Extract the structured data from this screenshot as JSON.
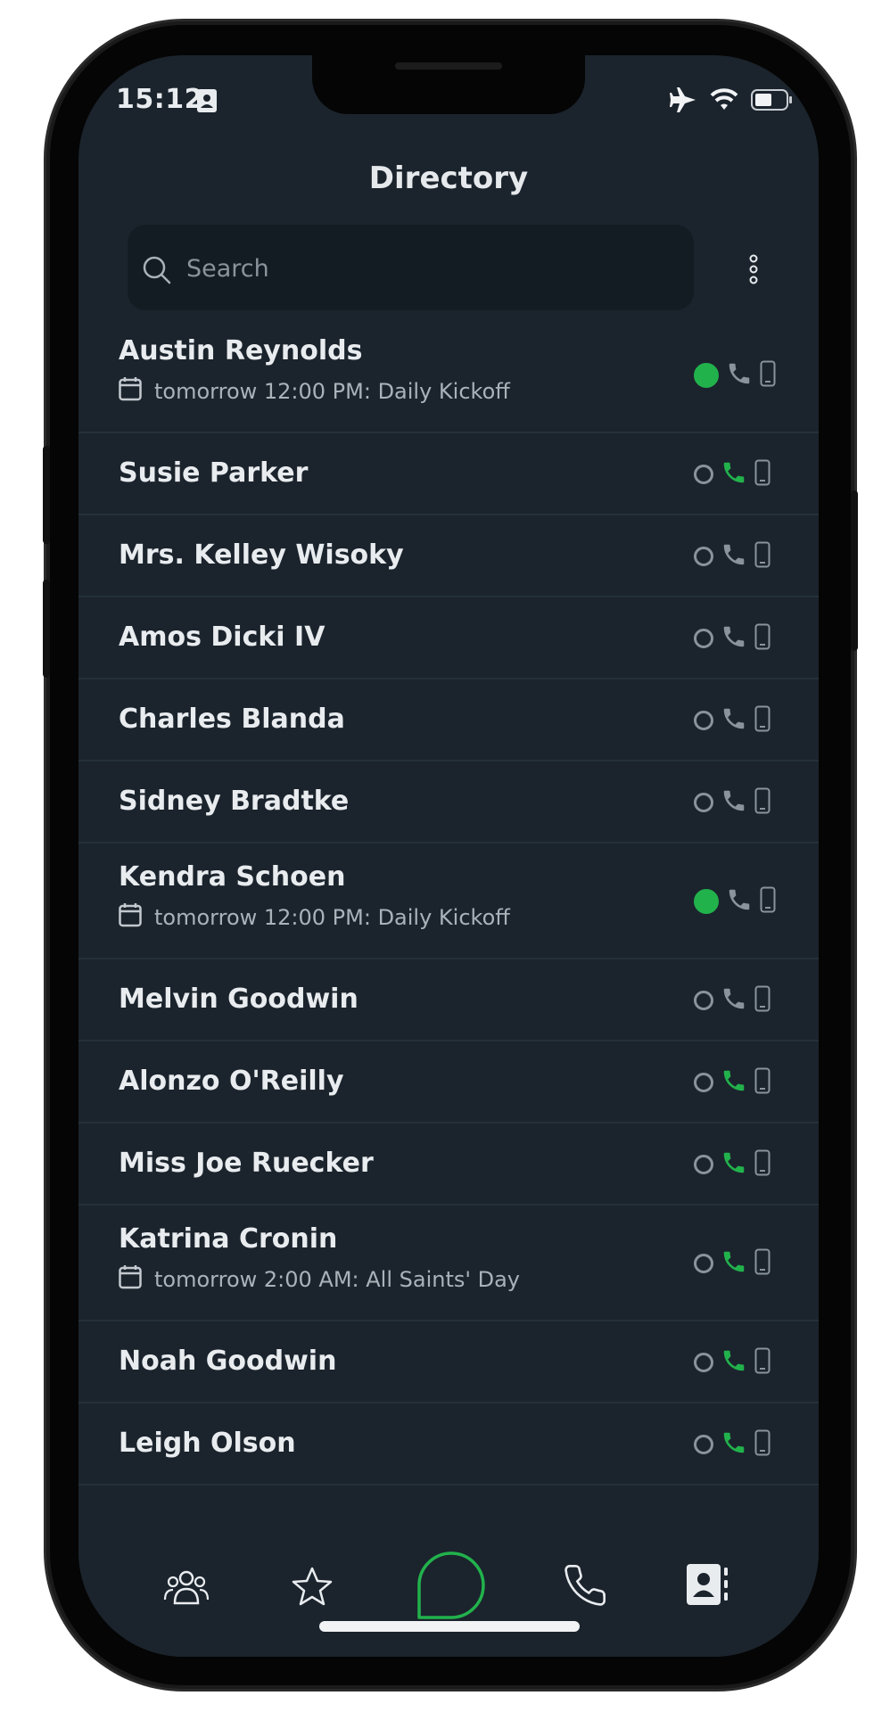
{
  "status_bar": {
    "time": "15:12",
    "icons": [
      "contact-card-icon",
      "airplane-icon",
      "wifi-icon",
      "battery-icon"
    ]
  },
  "header": {
    "title": "Directory"
  },
  "search": {
    "placeholder": "Search"
  },
  "colors": {
    "background": "#1b242d",
    "accent_green": "#22b24c",
    "text_primary": "#e9ecef",
    "text_secondary": "#aab2b9",
    "icon_gray": "#8a939b"
  },
  "contacts": [
    {
      "name": "Austin Reynolds",
      "event": "tomorrow 12:00 PM: Daily Kickoff",
      "online": true,
      "phone_active": false
    },
    {
      "name": "Susie Parker",
      "event": "",
      "online": false,
      "phone_active": true
    },
    {
      "name": "Mrs. Kelley Wisoky",
      "event": "",
      "online": false,
      "phone_active": false
    },
    {
      "name": "Amos Dicki IV",
      "event": "",
      "online": false,
      "phone_active": false
    },
    {
      "name": "Charles Blanda",
      "event": "",
      "online": false,
      "phone_active": false
    },
    {
      "name": "Sidney Bradtke",
      "event": "",
      "online": false,
      "phone_active": false
    },
    {
      "name": "Kendra Schoen",
      "event": "tomorrow 12:00 PM: Daily Kickoff",
      "online": true,
      "phone_active": false
    },
    {
      "name": "Melvin Goodwin",
      "event": "",
      "online": false,
      "phone_active": false
    },
    {
      "name": "Alonzo O'Reilly",
      "event": "",
      "online": false,
      "phone_active": true
    },
    {
      "name": "Miss Joe Ruecker",
      "event": "",
      "online": false,
      "phone_active": true
    },
    {
      "name": "Katrina Cronin",
      "event": "tomorrow 2:00 AM: All Saints' Day",
      "online": false,
      "phone_active": true
    },
    {
      "name": "Noah Goodwin",
      "event": "",
      "online": false,
      "phone_active": true
    },
    {
      "name": "Leigh Olson",
      "event": "",
      "online": false,
      "phone_active": true
    }
  ],
  "tabbar": {
    "tabs": [
      {
        "icon": "people-icon",
        "active": false
      },
      {
        "icon": "star-icon",
        "active": false
      },
      {
        "icon": "chat-bubble-icon",
        "active": false
      },
      {
        "icon": "phone-icon",
        "active": false
      },
      {
        "icon": "contacts-book-icon",
        "active": true
      }
    ]
  }
}
